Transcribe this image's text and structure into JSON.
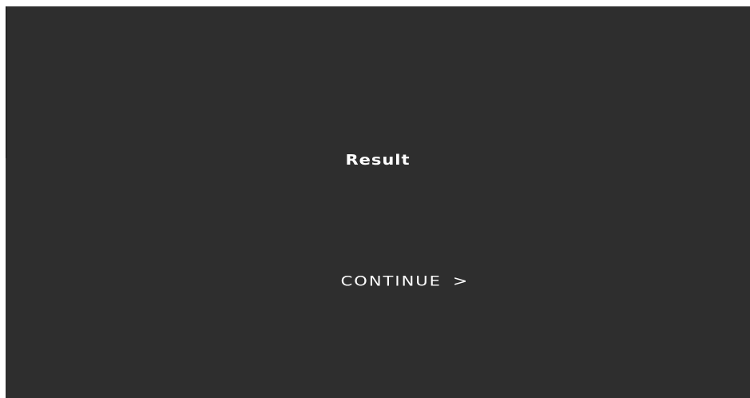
{
  "screen": {
    "title": "Result",
    "continue_label": "CONTINUE",
    "continue_arrow": ">",
    "background_color": "#2e2e2e",
    "text_color": "#ffffff"
  }
}
